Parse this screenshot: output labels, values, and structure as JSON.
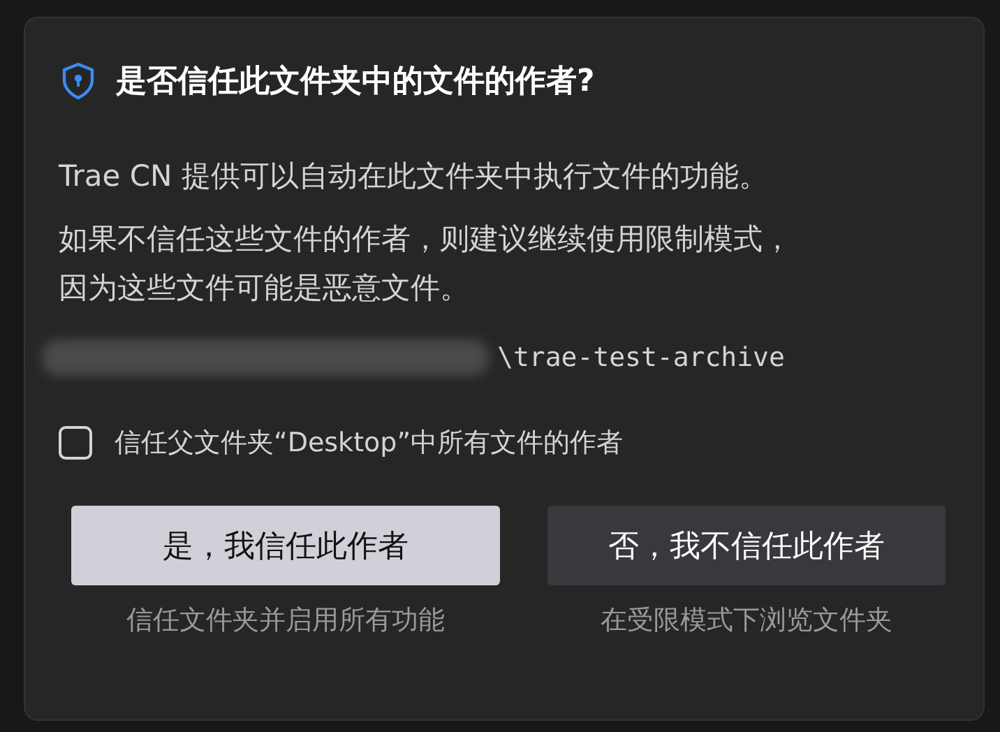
{
  "dialog": {
    "title": "是否信任此文件夹中的文件的作者?",
    "paragraphs": [
      "Trae CN 提供可以自动在此文件夹中执行文件的功能。",
      "如果不信任这些文件的作者，则建议继续使用限制模式，因为这些文件可能是恶意文件。"
    ],
    "path": {
      "visible_text": "\\trae-test-archive"
    },
    "checkbox": {
      "label": "信任父文件夹“Desktop”中所有文件的作者",
      "checked": false
    },
    "buttons": [
      {
        "kind": "primary",
        "label": "是，我信任此作者",
        "caption": "信任文件夹并启用所有功能"
      },
      {
        "kind": "secondary",
        "label": "否，我不信任此作者",
        "caption": "在受限模式下浏览文件夹"
      }
    ]
  }
}
